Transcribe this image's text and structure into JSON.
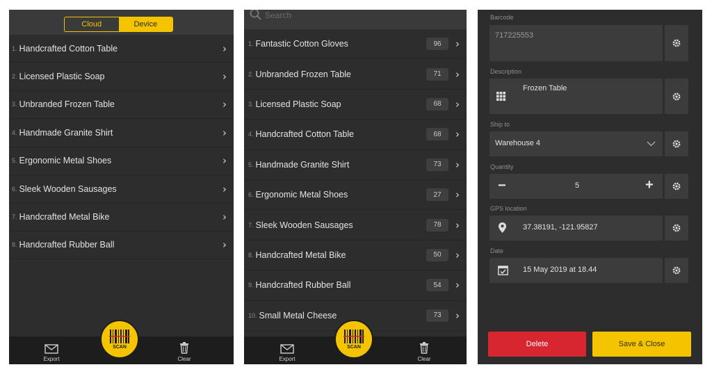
{
  "colors": {
    "accent": "#f4c400",
    "danger": "#d7262f",
    "background": "#2d2d2d"
  },
  "screen1": {
    "segmented": {
      "left": "Cloud",
      "right": "Device",
      "selected": "Device"
    },
    "items": [
      {
        "num": "1.",
        "label": "Handcrafted Cotton Table"
      },
      {
        "num": "2.",
        "label": "Licensed Plastic Soap"
      },
      {
        "num": "3.",
        "label": "Unbranded Frozen Table"
      },
      {
        "num": "4.",
        "label": "Handmade Granite Shirt"
      },
      {
        "num": "5.",
        "label": "Ergonomic Metal Shoes"
      },
      {
        "num": "6.",
        "label": "Sleek Wooden Sausages"
      },
      {
        "num": "7.",
        "label": "Handcrafted Metal Bike"
      },
      {
        "num": "8.",
        "label": "Handcrafted Rubber Ball"
      }
    ],
    "tabbar": {
      "export": "Export",
      "scan": "SCAN",
      "clear": "Clear"
    }
  },
  "screen2": {
    "search_placeholder": "Search",
    "items": [
      {
        "num": "1.",
        "label": "Fantastic Cotton Gloves",
        "count": "96"
      },
      {
        "num": "2.",
        "label": "Unbranded Frozen Table",
        "count": "71"
      },
      {
        "num": "3.",
        "label": "Licensed Plastic Soap",
        "count": "68"
      },
      {
        "num": "4.",
        "label": "Handcrafted Cotton Table",
        "count": "68"
      },
      {
        "num": "5.",
        "label": "Handmade Granite Shirt",
        "count": "73"
      },
      {
        "num": "6.",
        "label": "Ergonomic Metal Shoes",
        "count": "27"
      },
      {
        "num": "7.",
        "label": "Sleek Wooden Sausages",
        "count": "78"
      },
      {
        "num": "8.",
        "label": "Handcrafted Metal Bike",
        "count": "50"
      },
      {
        "num": "9.",
        "label": "Handcrafted Rubber Ball",
        "count": "54"
      },
      {
        "num": "10.",
        "label": "Small Metal Cheese",
        "count": "73"
      }
    ],
    "tabbar": {
      "export": "Export",
      "scan": "SCAN",
      "clear": "Clear"
    }
  },
  "screen3": {
    "barcode": {
      "label": "Barcode",
      "value": "717225553"
    },
    "description": {
      "label": "Description",
      "value": "Frozen Table"
    },
    "ship_to": {
      "label": "Ship to",
      "value": "Warehouse 4"
    },
    "quantity": {
      "label": "Quantity",
      "value": "5",
      "minus": "−",
      "plus": "+"
    },
    "gps": {
      "label": "GPS location",
      "value": "37.38191, -121.95827"
    },
    "date": {
      "label": "Date",
      "value": "15 May 2019 at 18.44"
    },
    "buttons": {
      "delete": "Delete",
      "save": "Save & Close"
    }
  }
}
